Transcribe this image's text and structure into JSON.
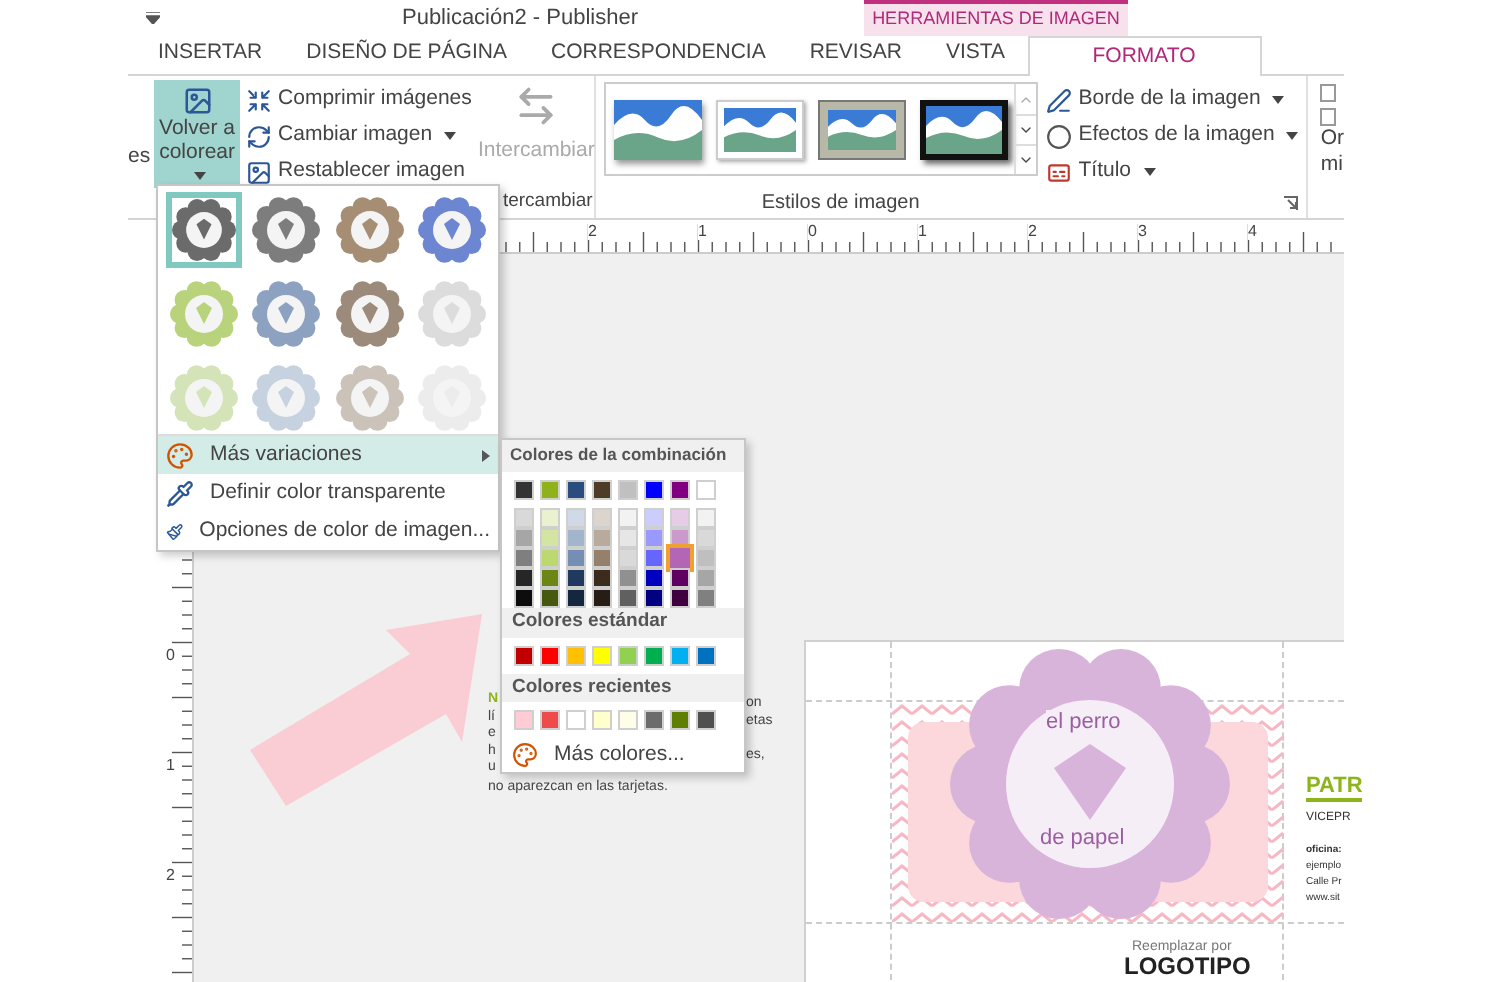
{
  "window": {
    "title": "Publicación2 - Publisher"
  },
  "contextual_tab_group": "HERRAMIENTAS DE IMAGEN",
  "tabs": [
    {
      "label": "INSERTAR",
      "selected": false
    },
    {
      "label": "DISEÑO DE PÁGINA",
      "selected": false
    },
    {
      "label": "CORRESPONDENCIA",
      "selected": false
    },
    {
      "label": "REVISAR",
      "selected": false
    },
    {
      "label": "VISTA",
      "selected": false
    },
    {
      "label": "FORMATO",
      "selected": true
    }
  ],
  "ribbon": {
    "cut_label_left": "es",
    "recolor_button": {
      "label": "Volver a colorear",
      "pressed": true
    },
    "adjust_buttons": [
      {
        "kind": "compress",
        "label": "Comprimir imágenes",
        "dropdown": false
      },
      {
        "kind": "change",
        "label": "Cambiar imagen",
        "dropdown": true
      },
      {
        "kind": "reset",
        "label": "Restablecer imagen",
        "dropdown": false
      }
    ],
    "swap_button": {
      "label": "Intercambiar",
      "disabled": true
    },
    "swap_group_label": "tercambiar",
    "styles_gallery": [
      {
        "kind": "shadow"
      },
      {
        "kind": "white-frame"
      },
      {
        "kind": "gray-frame"
      },
      {
        "kind": "black-frame"
      }
    ],
    "styles_group_label": "Estilos de imagen",
    "format_buttons": [
      {
        "kind": "border",
        "label": "Borde de la imagen"
      },
      {
        "kind": "effects",
        "label": "Efectos de la imagen"
      },
      {
        "kind": "caption",
        "label": "Título"
      }
    ],
    "cut_labels_right": [
      "Or",
      "mi"
    ]
  },
  "ruler": {
    "horizontal": [
      "2",
      "1",
      "0",
      "1",
      "2",
      "3",
      "4"
    ],
    "vertical": [
      "0",
      "1",
      "2"
    ]
  },
  "recolor_menu": {
    "presets": [
      {
        "color": "#6b6b6b",
        "selected": true
      },
      {
        "color": "#7d7d7d",
        "selected": false
      },
      {
        "color": "#a68e74",
        "selected": false
      },
      {
        "color": "#6d86d1",
        "selected": false
      },
      {
        "color": "#b9d37c",
        "selected": false
      },
      {
        "color": "#8da2c0",
        "selected": false
      },
      {
        "color": "#9c8a7a",
        "selected": false
      },
      {
        "color": "#dcdcdc",
        "selected": false
      },
      {
        "color": "#d5e4b8",
        "selected": false
      },
      {
        "color": "#c7d2e0",
        "selected": false
      },
      {
        "color": "#cbc2b9",
        "selected": false
      },
      {
        "color": "#ececec",
        "selected": false
      }
    ],
    "items": [
      {
        "kind": "variations",
        "label": "Más variaciones",
        "highlighted": true,
        "submenu": true
      },
      {
        "kind": "transparent",
        "label": "Definir color transparente",
        "highlighted": false,
        "submenu": false
      },
      {
        "kind": "options",
        "label": "Opciones de color de imagen...",
        "highlighted": false,
        "submenu": false
      }
    ]
  },
  "color_submenu": {
    "scheme_title": "Colores de la combinación",
    "scheme_base": [
      {
        "color": "#333333",
        "selected": false
      },
      {
        "color": "#8fb21c",
        "selected": false
      },
      {
        "color": "#2b4c7e",
        "selected": false
      },
      {
        "color": "#4e3b28",
        "selected": false
      },
      {
        "color": "#c0c0c0",
        "selected": false
      },
      {
        "color": "#0000ff",
        "selected": false
      },
      {
        "color": "#800080",
        "selected": false
      },
      {
        "color": "#ffffff",
        "selected": false
      }
    ],
    "scheme_shades": [
      [
        {
          "color": "#d9d9d9",
          "selected": false
        },
        {
          "color": "#e9f2cf",
          "selected": false
        },
        {
          "color": "#d0d9e6",
          "selected": false
        },
        {
          "color": "#dcd5ce",
          "selected": false
        },
        {
          "color": "#f2f2f2",
          "selected": false
        },
        {
          "color": "#ccccff",
          "selected": false
        },
        {
          "color": "#e6cce6",
          "selected": false
        },
        {
          "color": "#f2f2f2",
          "selected": false
        }
      ],
      [
        {
          "color": "#a6a6a6",
          "selected": false
        },
        {
          "color": "#d3e5a0",
          "selected": false
        },
        {
          "color": "#a3b4cd",
          "selected": false
        },
        {
          "color": "#b8ab9c",
          "selected": false
        },
        {
          "color": "#e6e6e6",
          "selected": false
        },
        {
          "color": "#9999ff",
          "selected": false
        },
        {
          "color": "#cc99cc",
          "selected": false
        },
        {
          "color": "#d9d9d9",
          "selected": false
        }
      ],
      [
        {
          "color": "#7f7f7f",
          "selected": false
        },
        {
          "color": "#bcd871",
          "selected": false
        },
        {
          "color": "#758fb4",
          "selected": false
        },
        {
          "color": "#95816b",
          "selected": false
        },
        {
          "color": "#d9d9d9",
          "selected": false
        },
        {
          "color": "#6666ff",
          "selected": false
        },
        {
          "color": "#b366b3",
          "selected": true
        },
        {
          "color": "#bfbfbf",
          "selected": false
        }
      ],
      [
        {
          "color": "#262626",
          "selected": false
        },
        {
          "color": "#6b8615",
          "selected": false
        },
        {
          "color": "#20395f",
          "selected": false
        },
        {
          "color": "#3b2c1e",
          "selected": false
        },
        {
          "color": "#909090",
          "selected": false
        },
        {
          "color": "#0000bf",
          "selected": false
        },
        {
          "color": "#600060",
          "selected": false
        },
        {
          "color": "#a6a6a6",
          "selected": false
        }
      ],
      [
        {
          "color": "#0d0d0d",
          "selected": false
        },
        {
          "color": "#47590e",
          "selected": false
        },
        {
          "color": "#15263f",
          "selected": false
        },
        {
          "color": "#271d14",
          "selected": false
        },
        {
          "color": "#606060",
          "selected": false
        },
        {
          "color": "#000080",
          "selected": false
        },
        {
          "color": "#400040",
          "selected": false
        },
        {
          "color": "#808080",
          "selected": false
        }
      ]
    ],
    "standard_title": "Colores estándar",
    "standard": [
      {
        "color": "#c00000",
        "selected": false
      },
      {
        "color": "#ff0000",
        "selected": false
      },
      {
        "color": "#ffc000",
        "selected": false
      },
      {
        "color": "#ffff00",
        "selected": false
      },
      {
        "color": "#92d050",
        "selected": false
      },
      {
        "color": "#00b050",
        "selected": false
      },
      {
        "color": "#00b0f0",
        "selected": false
      },
      {
        "color": "#0070c0",
        "selected": false
      }
    ],
    "recent_title": "Colores recientes",
    "recent": [
      {
        "color": "#ffccd5",
        "selected": false
      },
      {
        "color": "#ef4b4b",
        "selected": false
      },
      {
        "color": "#ffffff",
        "selected": false
      },
      {
        "color": "#ffffcc",
        "selected": false
      },
      {
        "color": "#fdfde8",
        "selected": false
      },
      {
        "color": "#6b6b6b",
        "selected": false
      },
      {
        "color": "#5f7f00",
        "selected": false
      },
      {
        "color": "#505050",
        "selected": false
      }
    ],
    "more_colors": "Más colores..."
  },
  "body_text_fragments": {
    "left": [
      "N",
      "lí",
      "e",
      "h",
      "u"
    ],
    "right": [
      "on",
      "etas",
      "es,"
    ],
    "last_line": "no aparezcan en las tarjetas."
  },
  "business_card": {
    "logo_top": "el perro",
    "logo_bottom": "de papel",
    "name": "PATR",
    "job_title": "VICEPR",
    "details": [
      "oficina:",
      "ejemplo",
      "Calle Pr",
      "www.sit"
    ],
    "placeholder_line_1": "Reemplazar por",
    "placeholder_line_2": "LOGOTIPO"
  }
}
